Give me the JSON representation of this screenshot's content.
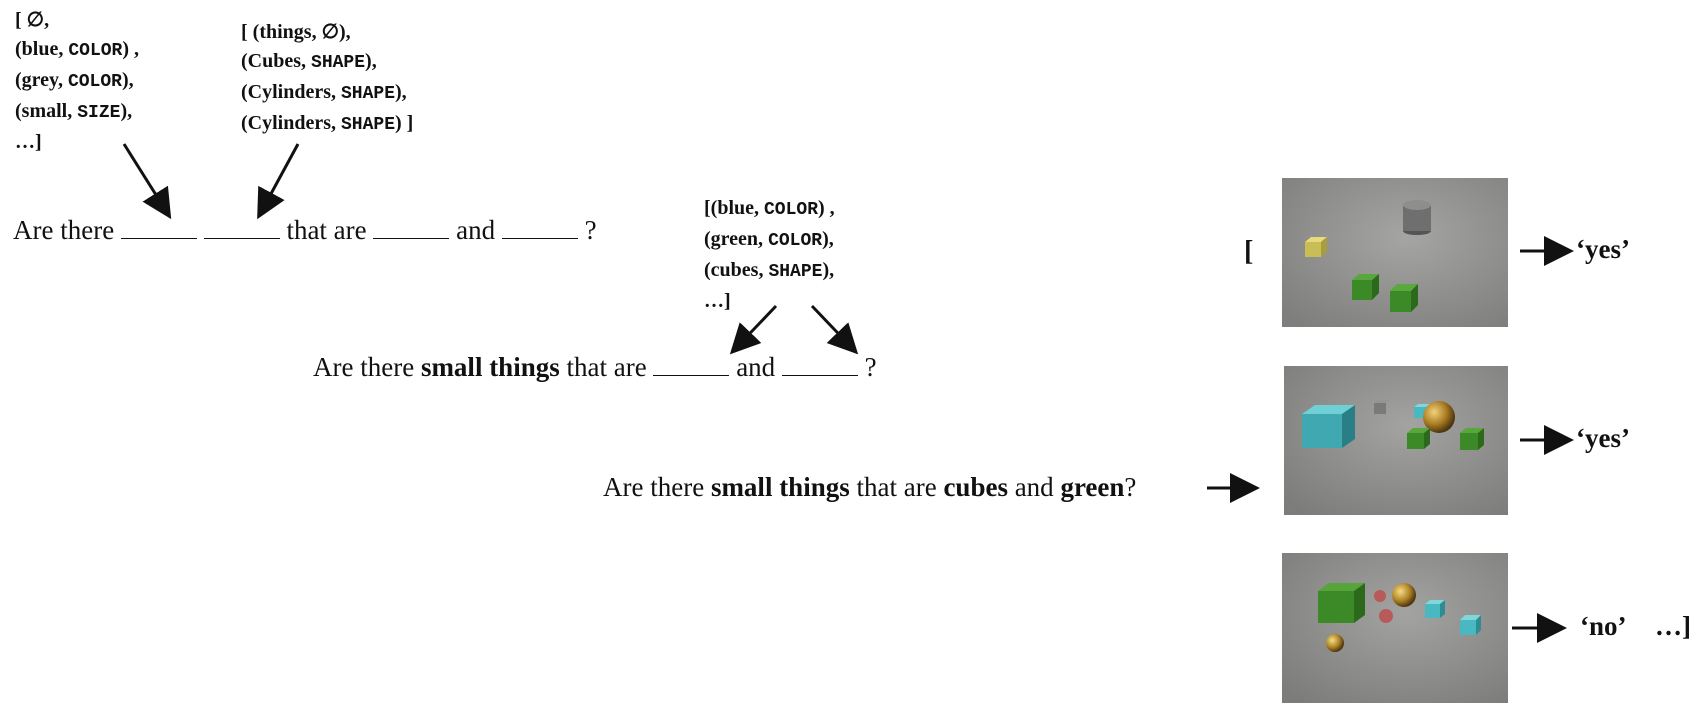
{
  "lists": {
    "first": [
      "[ ∅,",
      "(blue, |COLOR|) ,",
      "(grey, |COLOR|),",
      "(small, |SIZE|),",
      "…]"
    ],
    "second": [
      "[ (things, ∅),",
      "(Cubes, |SHAPE|),",
      "(Cylinders, |SHAPE|),",
      "(Cylinders, |SHAPE|) ]"
    ],
    "third": [
      "[(blue, |COLOR|) ,",
      "(green, |COLOR|),",
      "(cubes, |SHAPE|),",
      "…]"
    ]
  },
  "sentences": {
    "s1": {
      "p1": "Are there ",
      "p2": " that are ",
      "p3": " and ",
      "p4": " ?"
    },
    "s2": {
      "p1": "Are there ",
      "b1": "small things",
      "p2": " that are ",
      "p3": " and ",
      "p4": " ?"
    },
    "s3": {
      "p1": "Are there ",
      "b1": "small things",
      "p2": " that are ",
      "b2": "cubes",
      "p3": " and ",
      "b3": "green",
      "p4": "?"
    }
  },
  "answers": {
    "open_bracket": "[",
    "a1": "‘yes’",
    "a2": "‘yes’",
    "a3": "‘no’",
    "ellipsis": "…]"
  },
  "colors": {
    "scene_bg": "#8c8c8a",
    "green": "#3f8a2a",
    "cyan": "#4ab8c0",
    "gold": "#b58a2a",
    "grey": "#7a7a7a",
    "yellow": "#cdc25a",
    "red": "#b85a5a"
  }
}
